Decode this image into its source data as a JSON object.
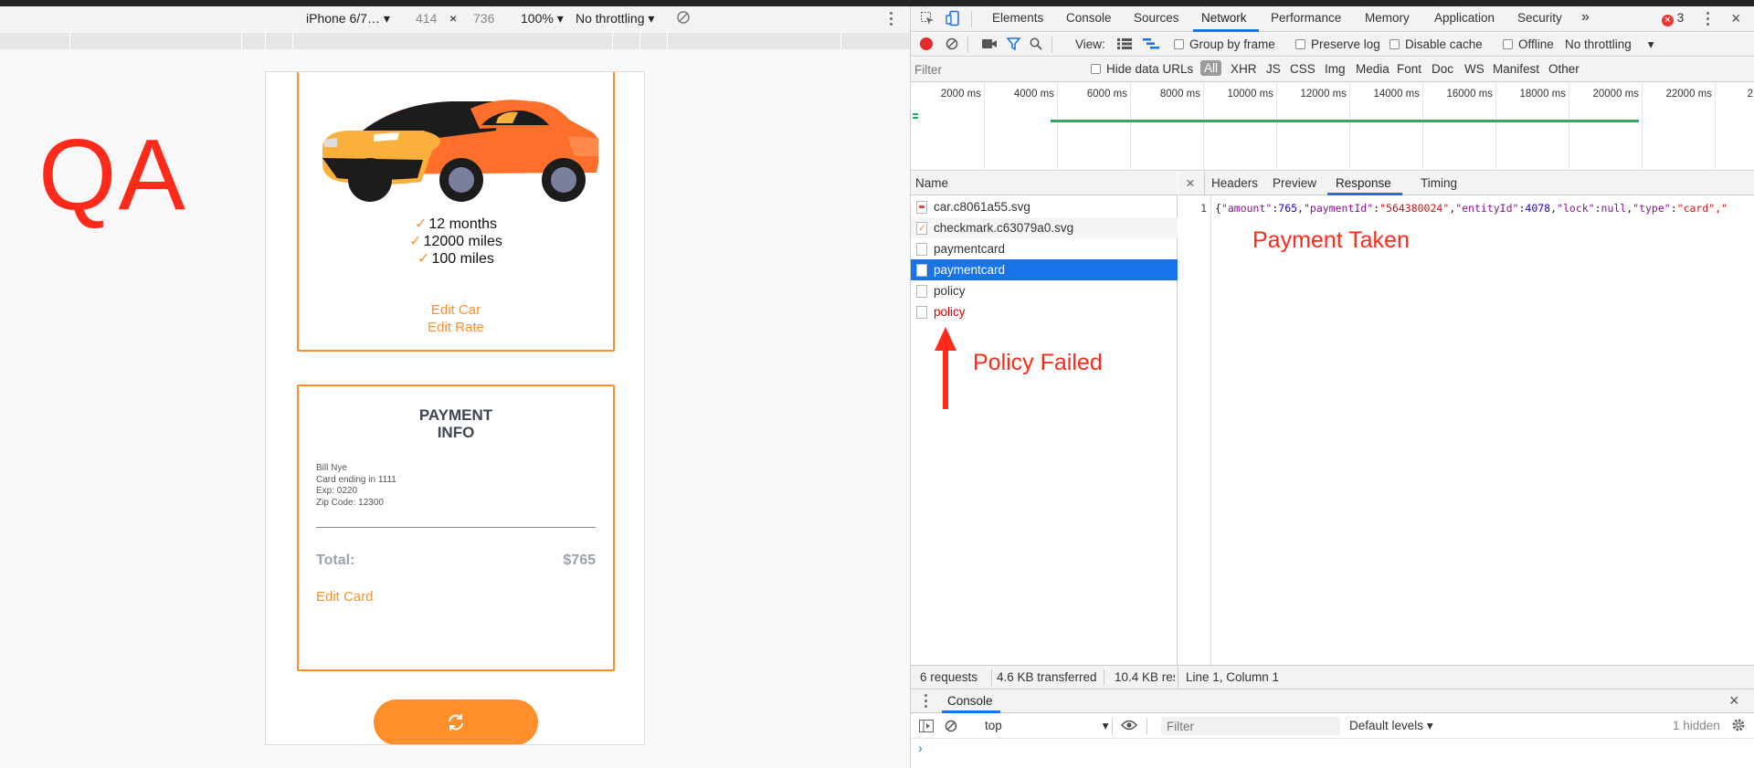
{
  "device_toolbar": {
    "device": "iPhone 6/7…",
    "width": "414",
    "times": "×",
    "height": "736",
    "zoom": "100%",
    "throttle": "No throttling"
  },
  "qa_label": "QA",
  "phone": {
    "coverage": [
      "12 months",
      "12000 miles",
      "100 miles"
    ],
    "edit_car": "Edit Car",
    "edit_rate": "Edit Rate",
    "payment_title_1": "PAYMENT",
    "payment_title_2": "INFO",
    "payment_details": [
      "Bill Nye",
      "Card ending in 1111",
      "Exp: 0220",
      "Zip Code: 12300"
    ],
    "total_label": "Total:",
    "total_value": "$765",
    "edit_card": "Edit Card"
  },
  "devtools": {
    "tabs": [
      "Elements",
      "Console",
      "Sources",
      "Network",
      "Performance",
      "Memory",
      "Application",
      "Security"
    ],
    "more": "»",
    "error_count": "3",
    "toolbar": {
      "view_label": "View:",
      "group_by_frame": "Group by frame",
      "preserve_log": "Preserve log",
      "disable_cache": "Disable cache",
      "offline": "Offline",
      "throttle": "No throttling"
    },
    "filter": {
      "placeholder": "Filter",
      "hide_data_urls": "Hide data URLs",
      "types": [
        "All",
        "XHR",
        "JS",
        "CSS",
        "Img",
        "Media",
        "Font",
        "Doc",
        "WS",
        "Manifest",
        "Other"
      ]
    },
    "timeline_ticks": [
      "2000 ms",
      "4000 ms",
      "6000 ms",
      "8000 ms",
      "10000 ms",
      "12000 ms",
      "14000 ms",
      "16000 ms",
      "18000 ms",
      "20000 ms",
      "22000 ms",
      "2"
    ],
    "name_header": "Name",
    "requests": [
      "car.c8061a55.svg",
      "checkmark.c63079a0.svg",
      "paymentcard",
      "paymentcard",
      "policy",
      "policy"
    ],
    "detail_tabs": [
      "Headers",
      "Preview",
      "Response",
      "Timing"
    ],
    "close_symbol": "×",
    "response_line_number": "1",
    "response": {
      "open": "{",
      "amount_key": "\"amount\"",
      "amount_val": "765",
      "paymentId_key": "\"paymentId\"",
      "paymentId_val": "\"564380024\"",
      "entityId_key": "\"entityId\"",
      "entityId_val": "4078",
      "lock_key": "\"lock\"",
      "lock_val": "null",
      "type_key": "\"type\"",
      "type_val": "\"card\"",
      "tail": ",\""
    },
    "status": {
      "requests": "6 requests",
      "transferred": "4.6 KB transferred",
      "resources": "10.4 KB res",
      "cursor": "Line 1, Column 1"
    },
    "console": {
      "title": "Console",
      "context": "top",
      "filter_placeholder": "Filter",
      "levels": "Default levels",
      "hidden": "1 hidden",
      "prompt": "›"
    }
  },
  "annotations": {
    "payment_taken": "Payment Taken",
    "policy_failed": "Policy Failed"
  },
  "colors": {
    "accent_orange": "#ff8e2b",
    "annotation_red": "#ff2a1a",
    "selection_blue": "#1a73e8",
    "timeline_green": "#16b55a"
  }
}
